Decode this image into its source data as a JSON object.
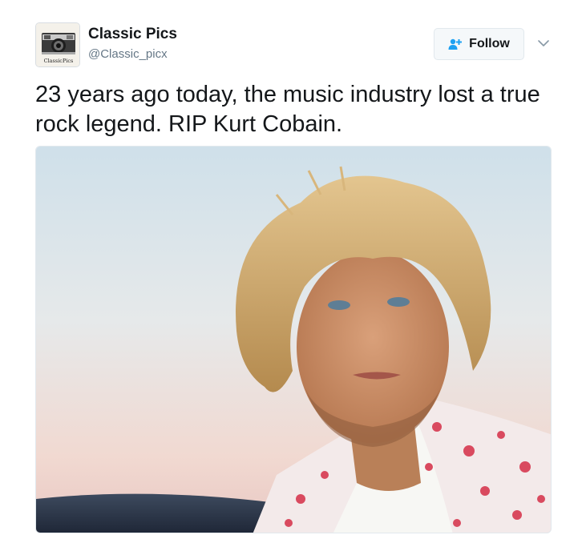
{
  "account": {
    "display_name": "Classic Pics",
    "handle": "@Classic_picx",
    "avatar_icon": "camera-icon",
    "avatar_caption": "ClassicPics"
  },
  "follow_button": {
    "label": "Follow",
    "icon": "add-user-icon",
    "accent": "#1da1f2"
  },
  "menu_icon": "chevron-down-icon",
  "tweet": {
    "text": "23 years ago today, the music industry lost a true rock legend. RIP Kurt Cobain."
  },
  "media": {
    "description_icon": "photo-portrait"
  }
}
